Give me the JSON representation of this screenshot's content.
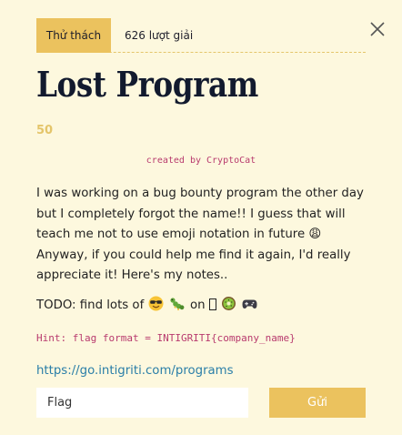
{
  "tabs": {
    "challenge_label": "Thử thách",
    "solves_label": "626 lượt giải"
  },
  "challenge": {
    "title": "Lost Program",
    "points": "50",
    "author": "created by CryptoCat",
    "description": "I was working on a bug bounty program the other day but I completely forgot the name!! I guess that will teach me not to use emoji notation in future 😩 Anyway, if you could help me find it again, I'd really appreciate it! Here's my notes..",
    "todo_prefix": "TODO: find lots of",
    "todo_middle": "on",
    "todo_emojis_before": [
      "smiling-face-with-sunglasses",
      "bug"
    ],
    "todo_emojis_after": [
      "unrendered-glyph",
      "kiwi-fruit",
      "video-game"
    ],
    "hint": "Hint: flag format = INTIGRITI{company_name}",
    "link": "https://go.intigriti.com/programs"
  },
  "form": {
    "flag_placeholder": "Flag",
    "submit_label": "Gửi"
  },
  "colors": {
    "background": "#fdf8de",
    "accent": "#ebc25e",
    "title": "#121a2e",
    "code_pink": "#b83a6e",
    "link_blue": "#2a7ea8"
  }
}
